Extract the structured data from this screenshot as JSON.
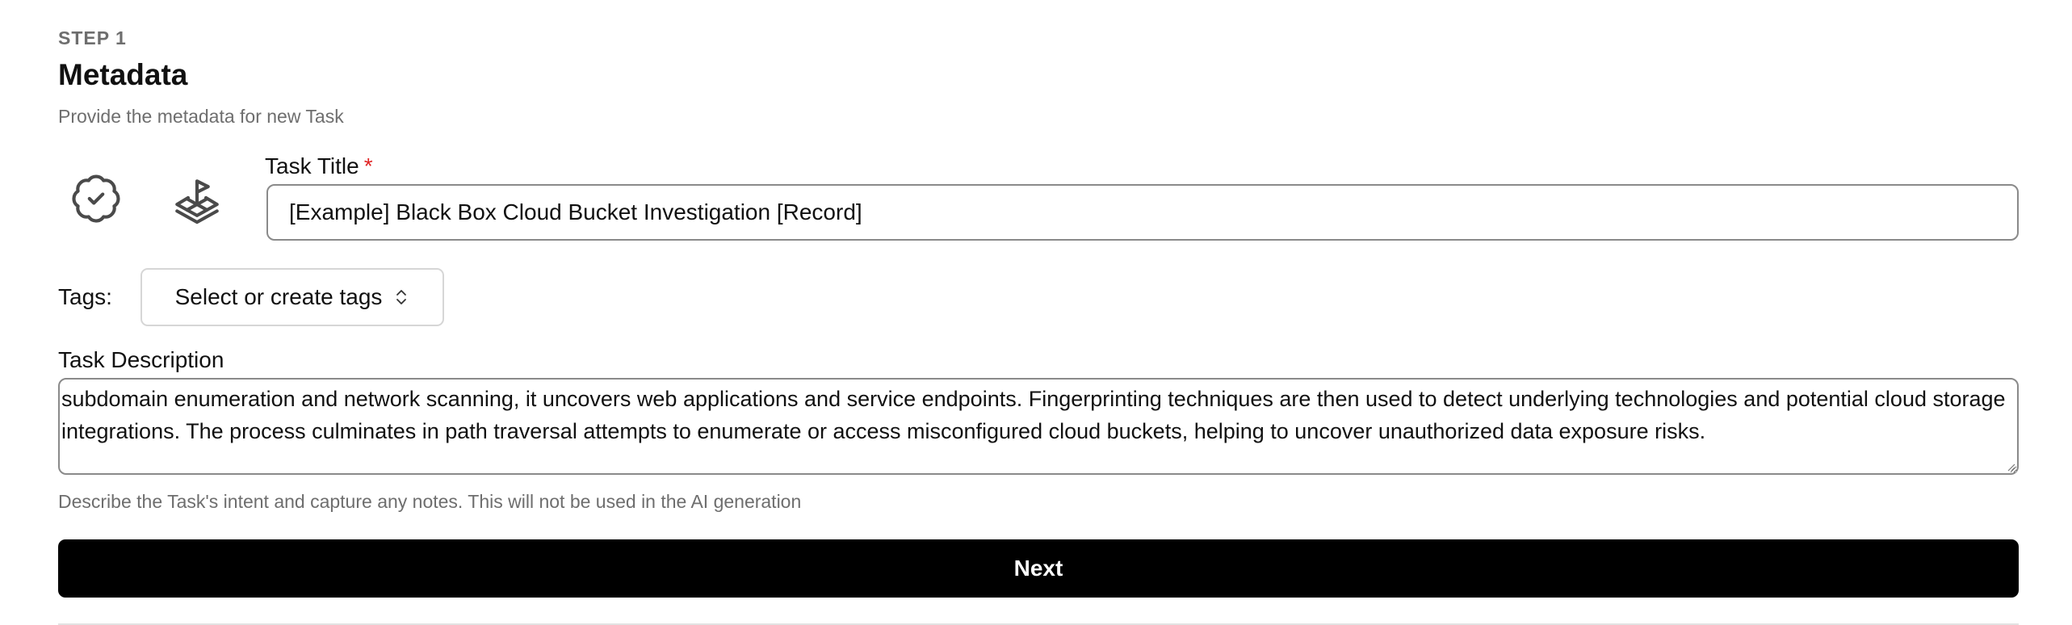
{
  "header": {
    "step": "STEP 1",
    "title": "Metadata",
    "subtitle": "Provide the metadata for new Task"
  },
  "icons": {
    "badge": "badge-check-icon",
    "scenario": "flag-layers-icon"
  },
  "task_title": {
    "label": "Task Title",
    "required_marker": "*",
    "value": "[Example] Black Box Cloud Bucket Investigation [Record]"
  },
  "tags": {
    "label": "Tags:",
    "button_label": "Select or create tags",
    "icon": "chevrons-up-down-icon"
  },
  "task_description": {
    "label": "Task Description",
    "value": "subdomain enumeration and network scanning, it uncovers web applications and service endpoints. Fingerprinting techniques are then used to detect underlying technologies and potential cloud storage integrations. The process culminates in path traversal attempts to enumerate or access misconfigured cloud buckets, helping to uncover unauthorized data exposure risks.",
    "hint": "Describe the Task's intent and capture any notes. This will not be used in the AI generation"
  },
  "actions": {
    "next_label": "Next"
  },
  "colors": {
    "required": "#e02424",
    "primary_button": "#000000",
    "muted_text": "#6e6e6e"
  }
}
